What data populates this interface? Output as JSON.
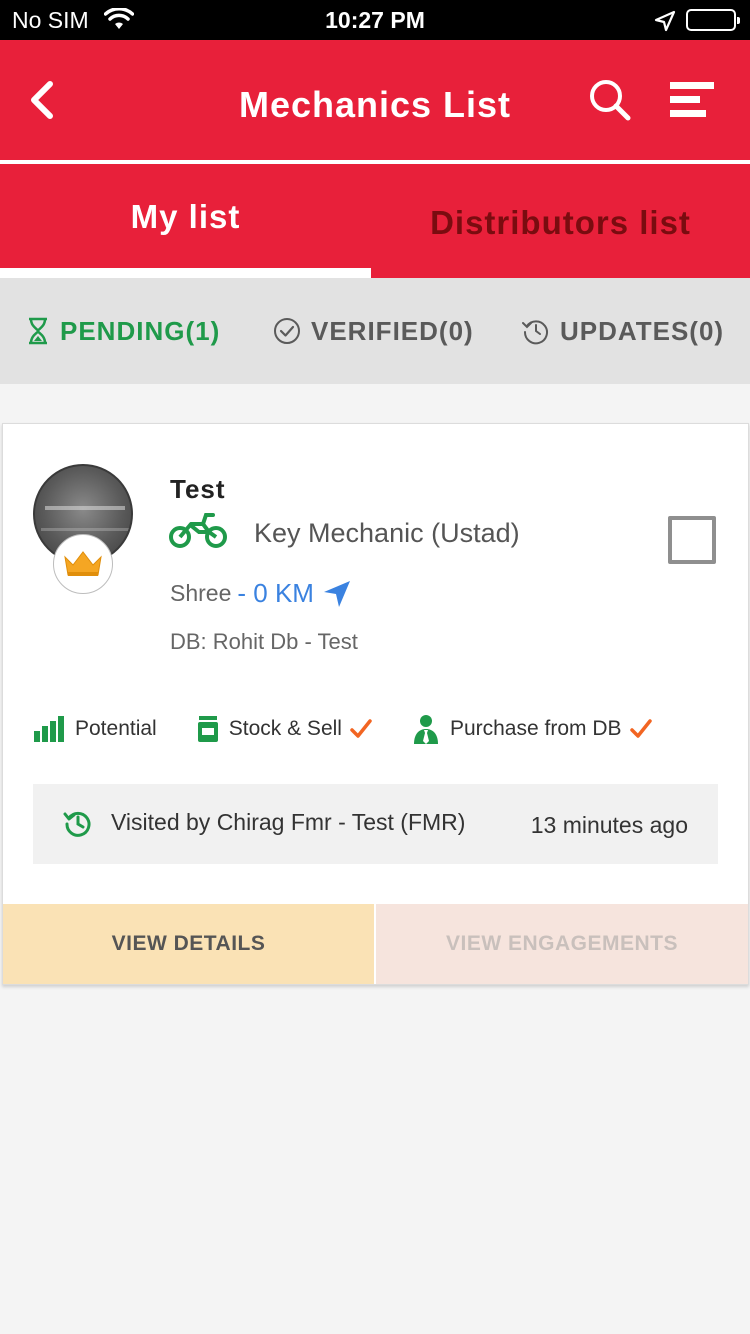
{
  "status_bar": {
    "carrier": "No SIM",
    "time": "10:27 PM"
  },
  "header": {
    "title": "Mechanics List",
    "icons": [
      "back-icon",
      "search-icon",
      "menu-icon"
    ]
  },
  "tabs": [
    {
      "label": "My list",
      "active": true
    },
    {
      "label": "Distributors list",
      "active": false
    }
  ],
  "filters": [
    {
      "label": "PENDING(1)",
      "icon": "hourglass-icon",
      "active": true
    },
    {
      "label": "VERIFIED(0)",
      "icon": "check-circle-icon",
      "active": false
    },
    {
      "label": "UPDATES(0)",
      "icon": "history-icon",
      "active": false
    }
  ],
  "mechanic": {
    "name": "Test",
    "type": "Key Mechanic (Ustad)",
    "area": "Shree",
    "distance": "- 0 KM",
    "db": "DB: Rohit Db - Test",
    "attributes": [
      {
        "label": "Potential",
        "icon": "signal-bars-icon",
        "checked": false
      },
      {
        "label": "Stock & Sell",
        "icon": "stock-box-icon",
        "checked": true
      },
      {
        "label": "Purchase from DB",
        "icon": "person-tie-icon",
        "checked": true
      }
    ],
    "visited_by": "Visited by Chirag Fmr - Test (FMR)",
    "visited_when": "13 minutes ago"
  },
  "actions": {
    "view_details": "VIEW DETAILS",
    "view_engagements": "VIEW ENGAGEMENTS"
  },
  "colors": {
    "brand_red": "#e8203a",
    "inactive_tab_text": "#7a0c10",
    "pending_green": "#1f9a4a",
    "distance_blue": "#3a82e0",
    "check_orange": "#f26522",
    "crown_gold": "#f5a623"
  }
}
